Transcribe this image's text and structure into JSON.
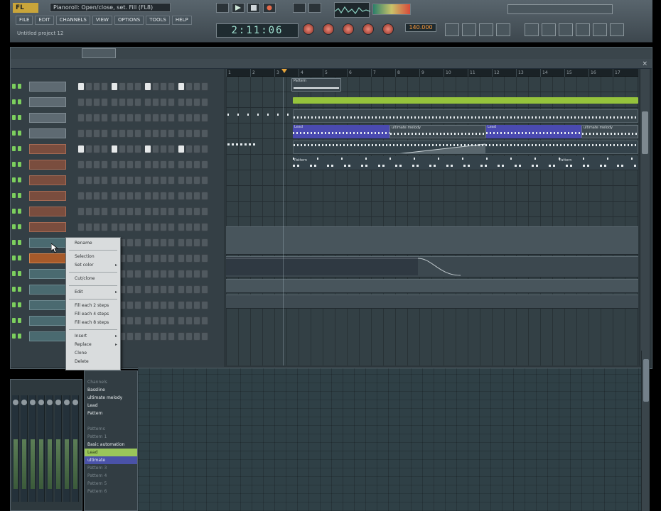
{
  "app": {
    "logo": "FL",
    "hint_text": "Pianoroll: Open/close, set. Fill (FL8)",
    "song_name": "Untitled project 12",
    "menu": [
      "FILE",
      "EDIT",
      "CHANNELS",
      "VIEW",
      "OPTIONS",
      "TOOLS",
      "HELP"
    ],
    "time_display": "2:11:06",
    "tempo": "140.000"
  },
  "playlist": {
    "bars": [
      "1",
      "2",
      "3",
      "4",
      "5",
      "6",
      "7",
      "8",
      "9",
      "10",
      "11",
      "12",
      "13",
      "14",
      "15",
      "16",
      "17"
    ],
    "clips": [
      {
        "label": "Pattern",
        "track": 0
      },
      {
        "label": "",
        "track": 1
      },
      {
        "label": "Lead",
        "track": 3
      },
      {
        "label": "ultimate melody",
        "track": 3
      },
      {
        "label": "Lead",
        "track": 3
      },
      {
        "label": "ultimate melody",
        "track": 3
      },
      {
        "label": "Pattern",
        "track": 4
      },
      {
        "label": "Pattern",
        "track": 4
      }
    ]
  },
  "context_menu": {
    "items": [
      {
        "label": "Rename",
        "submenu": false,
        "type": "item"
      },
      {
        "type": "sep"
      },
      {
        "label": "Selection",
        "submenu": false,
        "type": "item"
      },
      {
        "label": "Set color",
        "submenu": true,
        "type": "item"
      },
      {
        "type": "sep"
      },
      {
        "label": "Cut/clone",
        "submenu": false,
        "type": "item"
      },
      {
        "type": "sep"
      },
      {
        "label": "Edit",
        "submenu": true,
        "type": "item"
      },
      {
        "type": "sep"
      },
      {
        "label": "Fill each 2 steps",
        "submenu": false,
        "type": "item"
      },
      {
        "label": "Fill each 4 steps",
        "submenu": false,
        "type": "item"
      },
      {
        "label": "Fill each 8 steps",
        "submenu": false,
        "type": "item"
      },
      {
        "type": "sep"
      },
      {
        "label": "Insert",
        "submenu": true,
        "type": "item"
      },
      {
        "label": "Replace",
        "submenu": true,
        "type": "item"
      },
      {
        "label": "Clone",
        "submenu": false,
        "type": "item"
      },
      {
        "label": "Delete",
        "submenu": false,
        "type": "item"
      }
    ]
  },
  "browser": {
    "items": [
      {
        "label": "Channels",
        "style": "dim"
      },
      {
        "label": "Bassline",
        "style": "bright"
      },
      {
        "label": "ultimate melody",
        "style": "bright"
      },
      {
        "label": "Lead",
        "style": "bright"
      },
      {
        "label": "Pattern",
        "style": "bright"
      },
      {
        "label": "",
        "style": "dim"
      },
      {
        "label": "Patterns",
        "style": "dim"
      },
      {
        "label": "Pattern 1",
        "style": "dim"
      },
      {
        "label": "Basic automation",
        "style": "bright"
      },
      {
        "label": "Lead",
        "style": "green"
      },
      {
        "label": "ultimate",
        "style": "blue"
      },
      {
        "label": "Pattern 3",
        "style": "dim"
      },
      {
        "label": "Pattern 4",
        "style": "dim"
      },
      {
        "label": "Pattern 5",
        "style": "dim"
      },
      {
        "label": "Pattern 6",
        "style": "dim"
      }
    ]
  },
  "colors": {
    "clip_green": "#95c33c",
    "clip_blue": "#4a4ab0",
    "active_channel": "#a65a2a",
    "browser_green": "#9ac65a",
    "browser_blue": "#4a52a8"
  }
}
